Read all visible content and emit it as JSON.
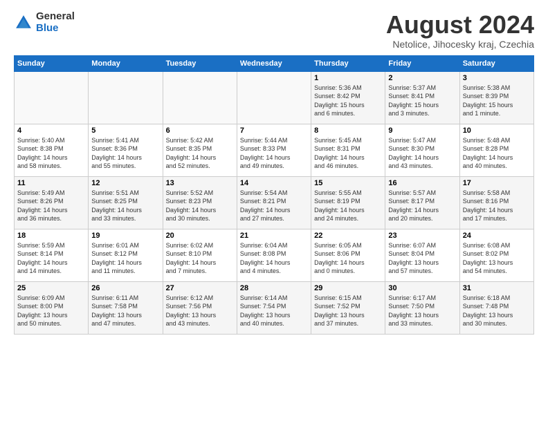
{
  "logo": {
    "general": "General",
    "blue": "Blue"
  },
  "title": "August 2024",
  "subtitle": "Netolice, Jihocesky kraj, Czechia",
  "weekdays": [
    "Sunday",
    "Monday",
    "Tuesday",
    "Wednesday",
    "Thursday",
    "Friday",
    "Saturday"
  ],
  "weeks": [
    [
      {
        "day": "",
        "info": ""
      },
      {
        "day": "",
        "info": ""
      },
      {
        "day": "",
        "info": ""
      },
      {
        "day": "",
        "info": ""
      },
      {
        "day": "1",
        "info": "Sunrise: 5:36 AM\nSunset: 8:42 PM\nDaylight: 15 hours\nand 6 minutes."
      },
      {
        "day": "2",
        "info": "Sunrise: 5:37 AM\nSunset: 8:41 PM\nDaylight: 15 hours\nand 3 minutes."
      },
      {
        "day": "3",
        "info": "Sunrise: 5:38 AM\nSunset: 8:39 PM\nDaylight: 15 hours\nand 1 minute."
      }
    ],
    [
      {
        "day": "4",
        "info": "Sunrise: 5:40 AM\nSunset: 8:38 PM\nDaylight: 14 hours\nand 58 minutes."
      },
      {
        "day": "5",
        "info": "Sunrise: 5:41 AM\nSunset: 8:36 PM\nDaylight: 14 hours\nand 55 minutes."
      },
      {
        "day": "6",
        "info": "Sunrise: 5:42 AM\nSunset: 8:35 PM\nDaylight: 14 hours\nand 52 minutes."
      },
      {
        "day": "7",
        "info": "Sunrise: 5:44 AM\nSunset: 8:33 PM\nDaylight: 14 hours\nand 49 minutes."
      },
      {
        "day": "8",
        "info": "Sunrise: 5:45 AM\nSunset: 8:31 PM\nDaylight: 14 hours\nand 46 minutes."
      },
      {
        "day": "9",
        "info": "Sunrise: 5:47 AM\nSunset: 8:30 PM\nDaylight: 14 hours\nand 43 minutes."
      },
      {
        "day": "10",
        "info": "Sunrise: 5:48 AM\nSunset: 8:28 PM\nDaylight: 14 hours\nand 40 minutes."
      }
    ],
    [
      {
        "day": "11",
        "info": "Sunrise: 5:49 AM\nSunset: 8:26 PM\nDaylight: 14 hours\nand 36 minutes."
      },
      {
        "day": "12",
        "info": "Sunrise: 5:51 AM\nSunset: 8:25 PM\nDaylight: 14 hours\nand 33 minutes."
      },
      {
        "day": "13",
        "info": "Sunrise: 5:52 AM\nSunset: 8:23 PM\nDaylight: 14 hours\nand 30 minutes."
      },
      {
        "day": "14",
        "info": "Sunrise: 5:54 AM\nSunset: 8:21 PM\nDaylight: 14 hours\nand 27 minutes."
      },
      {
        "day": "15",
        "info": "Sunrise: 5:55 AM\nSunset: 8:19 PM\nDaylight: 14 hours\nand 24 minutes."
      },
      {
        "day": "16",
        "info": "Sunrise: 5:57 AM\nSunset: 8:17 PM\nDaylight: 14 hours\nand 20 minutes."
      },
      {
        "day": "17",
        "info": "Sunrise: 5:58 AM\nSunset: 8:16 PM\nDaylight: 14 hours\nand 17 minutes."
      }
    ],
    [
      {
        "day": "18",
        "info": "Sunrise: 5:59 AM\nSunset: 8:14 PM\nDaylight: 14 hours\nand 14 minutes."
      },
      {
        "day": "19",
        "info": "Sunrise: 6:01 AM\nSunset: 8:12 PM\nDaylight: 14 hours\nand 11 minutes."
      },
      {
        "day": "20",
        "info": "Sunrise: 6:02 AM\nSunset: 8:10 PM\nDaylight: 14 hours\nand 7 minutes."
      },
      {
        "day": "21",
        "info": "Sunrise: 6:04 AM\nSunset: 8:08 PM\nDaylight: 14 hours\nand 4 minutes."
      },
      {
        "day": "22",
        "info": "Sunrise: 6:05 AM\nSunset: 8:06 PM\nDaylight: 14 hours\nand 0 minutes."
      },
      {
        "day": "23",
        "info": "Sunrise: 6:07 AM\nSunset: 8:04 PM\nDaylight: 13 hours\nand 57 minutes."
      },
      {
        "day": "24",
        "info": "Sunrise: 6:08 AM\nSunset: 8:02 PM\nDaylight: 13 hours\nand 54 minutes."
      }
    ],
    [
      {
        "day": "25",
        "info": "Sunrise: 6:09 AM\nSunset: 8:00 PM\nDaylight: 13 hours\nand 50 minutes."
      },
      {
        "day": "26",
        "info": "Sunrise: 6:11 AM\nSunset: 7:58 PM\nDaylight: 13 hours\nand 47 minutes."
      },
      {
        "day": "27",
        "info": "Sunrise: 6:12 AM\nSunset: 7:56 PM\nDaylight: 13 hours\nand 43 minutes."
      },
      {
        "day": "28",
        "info": "Sunrise: 6:14 AM\nSunset: 7:54 PM\nDaylight: 13 hours\nand 40 minutes."
      },
      {
        "day": "29",
        "info": "Sunrise: 6:15 AM\nSunset: 7:52 PM\nDaylight: 13 hours\nand 37 minutes."
      },
      {
        "day": "30",
        "info": "Sunrise: 6:17 AM\nSunset: 7:50 PM\nDaylight: 13 hours\nand 33 minutes."
      },
      {
        "day": "31",
        "info": "Sunrise: 6:18 AM\nSunset: 7:48 PM\nDaylight: 13 hours\nand 30 minutes."
      }
    ]
  ]
}
